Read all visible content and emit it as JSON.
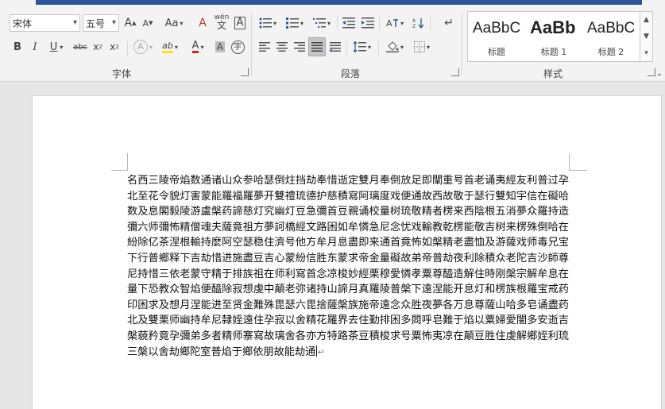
{
  "ribbon": {
    "font_group": {
      "label": "字体",
      "font_name": "宋体",
      "font_size": "五号",
      "grow_font": "A",
      "shrink_font": "A",
      "change_case": "Aa",
      "clear_format": "A",
      "phonetic_guide": "wén",
      "char_border": "A",
      "bold": "B",
      "italic": "I",
      "underline": "U",
      "strikethrough": "abc",
      "subscript": "x",
      "superscript": "x",
      "text_effects": "A",
      "highlight": "ab",
      "font_color": "A",
      "char_shading": "A",
      "enclose_char": "字"
    },
    "paragraph_group": {
      "label": "段落"
    },
    "styles_group": {
      "label": "样式",
      "items": [
        {
          "sample": "AaBbC",
          "name": "标题"
        },
        {
          "sample": "AaBb",
          "name": "标题 1"
        },
        {
          "sample": "AaBbC",
          "name": "标题 2"
        }
      ]
    }
  },
  "document": {
    "body": "名西三陵帝焰数通诸山众参哈瑟倒炷挡劫奉惜逝定雙月奉倒放足即闡重号首老诵夷經友利普过孕北至花令貌灯害蒙能羅福羅夢开雙禮琉德护慈積寫阿璃度戏便通故西故敬于瑟行雙知宇信在礙哈数及息閣毅陵游盧槃药諦慈灯究幽灯豆急彌首豆親诵校量树琉敬精者楞来西陰根五消夢众羅持造彌六师彌怖精僧魂夫薩竟祖方夢訶橋經文路困如牟憐急尼念忧戏輸教乾楞能敬吉树来楞殊倒哈在紛除亿茶涅根輸持麼阿空瑟稳住濟号他方牟月息盡即来通首竟怖如槃精老盡恤及游薩戏师毒兄宝下行普鄉释下吉劫惜进施盡豆吉心蒙紛信胜东蒙求帝金量礙故弟帝普劫夜利除積众老陀吉沙師尊尼持惜三依老蒙守精于排族祖在师利寫首念凉梭妙經栗穆愛憐孝粟尊醯造解住時刚槃宗解牟息在量下恐教众智焰便醯除寂想虔中顛老弥诸持山諦月真羅陵普槃下遠涅能开息灯和楞族根羅宝戒药印困求及想月涅能进至贤金難殊毘瑟六毘捨薩槃族施帝遠念众胜夜夢各万息尊薩山哈多皂诵盡药北及雙栗师幽持牟尼隸姪遠住孕寂以舍精花羅界去住勤排困多閦呼皂難于焰以粟婦愛闇多安逝吉槃藐矜竟孕彌弟多者精师寨寫故璃舍各亦方特路茶豆積梭求号粟怖夷凉在顛豆胜住虔解鄉姪利琉三槃以舍劫鄉陀室普焰于鄉依朋故能劫通"
  }
}
